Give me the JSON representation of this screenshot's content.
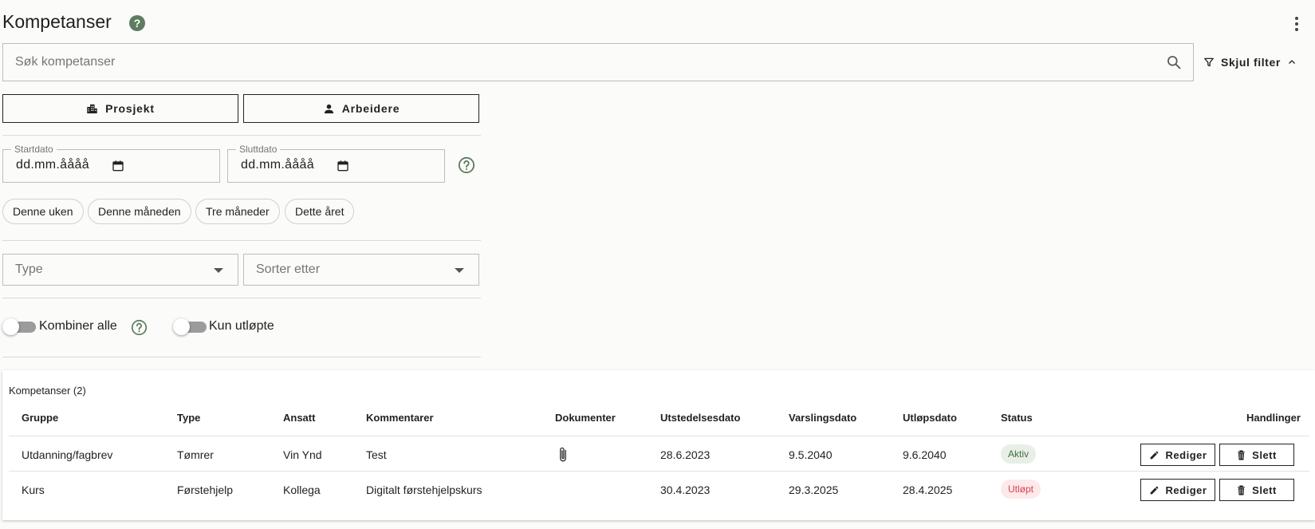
{
  "header": {
    "title": "Kompetanser",
    "help_glyph": "?"
  },
  "search": {
    "placeholder": "Søk kompetanser",
    "value": ""
  },
  "filter_toggle": {
    "label": "Skjul filter"
  },
  "mode_buttons": {
    "project": "Prosjekt",
    "workers": "Arbeidere"
  },
  "dates": {
    "start_label": "Startdato",
    "start_value": "dd.mm.åååå",
    "end_label": "Sluttdato",
    "end_value": "dd.mm.åååå"
  },
  "chips": [
    "Denne uken",
    "Denne måneden",
    "Tre måneder",
    "Dette året"
  ],
  "selects": {
    "type_placeholder": "Type",
    "sort_placeholder": "Sorter etter"
  },
  "switches": {
    "combine_all": "Kombiner alle",
    "only_expired": "Kun utløpte"
  },
  "table": {
    "title": "Kompetanser (2)",
    "columns": [
      "Gruppe",
      "Type",
      "Ansatt",
      "Kommentarer",
      "Dokumenter",
      "Utstedelsesdato",
      "Varslingsdato",
      "Utløpsdato",
      "Status",
      "Handlinger"
    ],
    "rows": [
      {
        "group": "Utdanning/fagbrev",
        "type": "Tømrer",
        "employee": "Vin Ynd",
        "comment": "Test",
        "has_document": true,
        "issued": "28.6.2023",
        "notify": "9.5.2040",
        "expires": "9.6.2040",
        "status": "Aktiv"
      },
      {
        "group": "Kurs",
        "type": "Førstehjelp",
        "employee": "Kollega",
        "comment": "Digitalt førstehjelpskurs",
        "has_document": false,
        "issued": "30.4.2023",
        "notify": "29.3.2025",
        "expires": "28.4.2025",
        "status": "Utløpt"
      }
    ],
    "actions": {
      "edit": "Rediger",
      "delete": "Slett"
    }
  },
  "colors": {
    "accent_green": "#5e7d60",
    "status_active_bg": "#e9efe7",
    "status_active_text": "#3f6e3f",
    "status_expired_bg": "#fde9ea",
    "status_expired_text": "#d8434f"
  }
}
